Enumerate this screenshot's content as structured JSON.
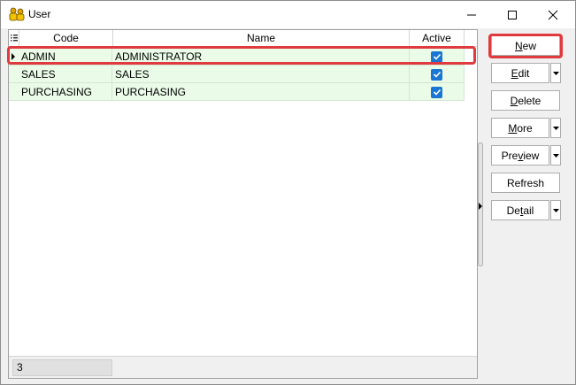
{
  "window": {
    "title": "User",
    "icons": {
      "app": "users-app-icon",
      "minimize": "minimize-icon",
      "maximize": "maximize-icon",
      "close": "close-icon"
    }
  },
  "grid": {
    "columns": {
      "code": "Code",
      "name": "Name",
      "active": "Active"
    },
    "rows": [
      {
        "code": "ADMIN",
        "name": "ADMINISTRATOR",
        "active": true,
        "current": true
      },
      {
        "code": "SALES",
        "name": "SALES",
        "active": true,
        "current": false
      },
      {
        "code": "PURCHASING",
        "name": "PURCHASING",
        "active": true,
        "current": false
      }
    ],
    "record_count": "3"
  },
  "buttons": {
    "new": {
      "pre": "",
      "key": "N",
      "post": "ew"
    },
    "edit": {
      "pre": "",
      "key": "E",
      "post": "dit"
    },
    "delete": {
      "pre": "",
      "key": "D",
      "post": "elete"
    },
    "more": {
      "pre": "",
      "key": "M",
      "post": "ore"
    },
    "preview": {
      "pre": "Pre",
      "key": "v",
      "post": "iew"
    },
    "refresh": {
      "pre": "Refresh",
      "key": "",
      "post": ""
    },
    "detail": {
      "pre": "De",
      "key": "t",
      "post": "ail"
    }
  },
  "colors": {
    "row_bg": "#eafbe8",
    "highlight": "#e0393e",
    "checkbox": "#1976d2"
  }
}
